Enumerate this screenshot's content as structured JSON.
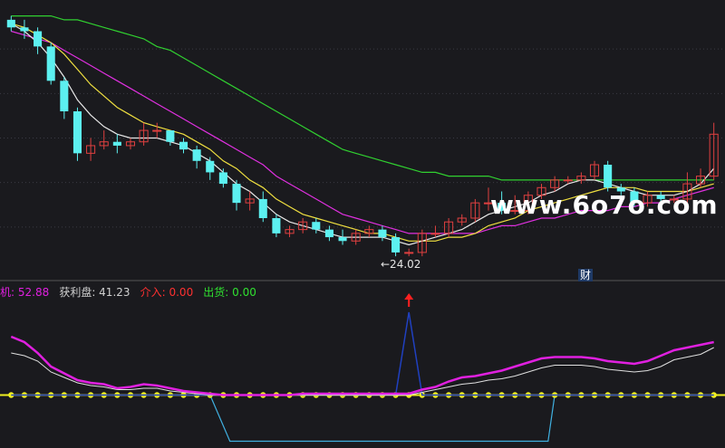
{
  "colors": {
    "background": "#1a1a1e",
    "gridline": "#3a3a44",
    "up_candle": "#e04040",
    "down_candle": "#5cf0f0",
    "ma_white": "#e8e8e8",
    "ma_yellow": "#f0e040",
    "ma_magenta": "#e030e0",
    "ma_green": "#30d030",
    "ind_magenta": "#e020e0",
    "ind_white": "#e0e0e0",
    "ind_yellow": "#f0f020",
    "ind_blue": "#2040c0",
    "ind_cyan": "#40b0e0",
    "signal_red": "#ff2020"
  },
  "chart_labels": {
    "low_price_label": "←24.02",
    "event_marker": "财",
    "watermark": "www.6o7o.com"
  },
  "indicator_bar": [
    {
      "text": "机: 52.88",
      "color": "#e020e0"
    },
    {
      "text": "获利盘: 41.23",
      "color": "#d0d0d0"
    },
    {
      "text": "介入: 0.00",
      "color": "#ff3030"
    },
    {
      "text": "出货: 0.00",
      "color": "#30e030"
    }
  ],
  "chart_data": [
    {
      "type": "candlestick",
      "x": [
        1,
        2,
        3,
        4,
        5,
        6,
        7,
        8,
        9,
        10,
        11,
        12,
        13,
        14,
        15,
        16,
        17,
        18,
        19,
        20,
        21,
        22,
        23,
        24,
        25,
        26,
        27,
        28,
        29,
        30,
        31,
        32,
        33,
        34,
        35,
        36,
        37,
        38,
        39,
        40,
        41,
        42,
        43,
        44,
        45,
        46,
        47,
        48,
        49,
        50,
        51,
        52,
        53,
        54
      ],
      "open": [
        30.2,
        30.0,
        29.9,
        29.5,
        28.6,
        27.8,
        26.7,
        26.9,
        27.0,
        26.9,
        27.0,
        27.3,
        27.3,
        27.0,
        26.8,
        26.5,
        26.2,
        25.9,
        25.4,
        25.5,
        25.0,
        24.6,
        24.7,
        24.9,
        24.7,
        24.5,
        24.4,
        24.6,
        24.7,
        24.5,
        24.1,
        24.1,
        24.6,
        24.6,
        24.9,
        25.0,
        25.4,
        25.4,
        25.2,
        25.2,
        25.6,
        25.8,
        26.0,
        26.0,
        26.1,
        26.4,
        25.8,
        25.7,
        25.4,
        25.6,
        25.5,
        25.5,
        25.9,
        26.1
      ],
      "close": [
        30.0,
        29.9,
        29.5,
        28.6,
        27.8,
        26.7,
        26.9,
        27.0,
        26.9,
        27.0,
        27.3,
        27.3,
        27.0,
        26.8,
        26.5,
        26.2,
        25.9,
        25.4,
        25.5,
        25.0,
        24.6,
        24.7,
        24.9,
        24.7,
        24.5,
        24.4,
        24.6,
        24.7,
        24.5,
        24.1,
        24.1,
        24.6,
        24.6,
        24.9,
        25.0,
        25.4,
        25.4,
        25.2,
        25.2,
        25.6,
        25.8,
        26.0,
        26.0,
        26.1,
        26.4,
        25.8,
        25.7,
        25.4,
        25.6,
        25.5,
        25.5,
        25.9,
        26.1,
        27.2
      ],
      "high": [
        30.3,
        30.2,
        30.0,
        29.6,
        28.7,
        27.9,
        27.1,
        27.3,
        27.2,
        27.1,
        27.5,
        27.5,
        27.3,
        27.1,
        26.9,
        26.6,
        26.3,
        26.0,
        25.7,
        25.7,
        25.1,
        24.8,
        25.0,
        25.0,
        24.8,
        24.7,
        24.7,
        24.8,
        24.8,
        24.6,
        24.2,
        24.7,
        24.8,
        25.0,
        25.1,
        25.5,
        25.8,
        25.7,
        25.6,
        25.7,
        25.9,
        26.1,
        26.1,
        26.2,
        26.5,
        26.5,
        25.9,
        25.8,
        25.7,
        25.7,
        25.6,
        26.2,
        26.3,
        27.5
      ],
      "low": [
        29.9,
        29.7,
        29.3,
        28.5,
        27.6,
        26.5,
        26.5,
        26.8,
        26.7,
        26.8,
        26.9,
        27.1,
        26.9,
        26.7,
        26.3,
        26.0,
        25.8,
        25.2,
        25.2,
        24.9,
        24.5,
        24.5,
        24.6,
        24.6,
        24.4,
        24.3,
        24.3,
        24.5,
        24.4,
        24.0,
        24.0,
        24.0,
        24.5,
        24.5,
        24.8,
        24.9,
        25.2,
        25.1,
        25.1,
        25.1,
        25.5,
        25.7,
        25.9,
        25.9,
        26.0,
        25.7,
        25.6,
        25.3,
        25.3,
        25.4,
        25.4,
        25.4,
        25.8,
        26.0
      ],
      "ma_white": [
        30.1,
        29.9,
        29.6,
        29.2,
        28.7,
        28.1,
        27.7,
        27.4,
        27.2,
        27.1,
        27.1,
        27.1,
        27.0,
        26.9,
        26.7,
        26.5,
        26.2,
        25.9,
        25.7,
        25.4,
        25.1,
        24.9,
        24.8,
        24.7,
        24.6,
        24.5,
        24.5,
        24.5,
        24.5,
        24.4,
        24.3,
        24.4,
        24.5,
        24.6,
        24.7,
        24.9,
        25.1,
        25.2,
        25.3,
        25.4,
        25.6,
        25.7,
        25.9,
        26.0,
        26.0,
        25.9,
        25.8,
        25.7,
        25.6,
        25.6,
        25.6,
        25.7,
        25.9,
        26.3
      ],
      "ma_yellow": [
        30.1,
        30.0,
        29.8,
        29.6,
        29.3,
        28.9,
        28.5,
        28.2,
        27.9,
        27.7,
        27.5,
        27.4,
        27.3,
        27.2,
        27.0,
        26.8,
        26.5,
        26.3,
        26.0,
        25.8,
        25.5,
        25.3,
        25.1,
        25.0,
        24.9,
        24.8,
        24.7,
        24.6,
        24.6,
        24.5,
        24.4,
        24.4,
        24.4,
        24.5,
        24.5,
        24.6,
        24.8,
        24.9,
        25.0,
        25.2,
        25.3,
        25.4,
        25.5,
        25.6,
        25.7,
        25.8,
        25.8,
        25.8,
        25.7,
        25.7,
        25.7,
        25.7,
        25.8,
        25.9
      ],
      "ma_magenta": [
        29.9,
        29.8,
        29.7,
        29.6,
        29.4,
        29.2,
        29.0,
        28.8,
        28.6,
        28.4,
        28.2,
        28.0,
        27.8,
        27.6,
        27.4,
        27.2,
        27.0,
        26.8,
        26.6,
        26.4,
        26.1,
        25.9,
        25.7,
        25.5,
        25.3,
        25.1,
        25.0,
        24.9,
        24.8,
        24.7,
        24.6,
        24.6,
        24.6,
        24.6,
        24.6,
        24.6,
        24.7,
        24.8,
        24.8,
        24.9,
        25.0,
        25.0,
        25.1,
        25.2,
        25.2,
        25.2,
        25.3,
        25.3,
        25.4,
        25.4,
        25.5,
        25.6,
        25.7,
        25.8
      ],
      "ma_green": [
        30.3,
        30.3,
        30.3,
        30.3,
        30.2,
        30.2,
        30.1,
        30.0,
        29.9,
        29.8,
        29.7,
        29.5,
        29.4,
        29.2,
        29.0,
        28.8,
        28.6,
        28.4,
        28.2,
        28.0,
        27.8,
        27.6,
        27.4,
        27.2,
        27.0,
        26.8,
        26.7,
        26.6,
        26.5,
        26.4,
        26.3,
        26.2,
        26.2,
        26.1,
        26.1,
        26.1,
        26.1,
        26.0,
        26.0,
        26.0,
        26.0,
        26.0,
        26.0,
        26.0,
        26.0,
        26.0,
        26.0,
        26.0,
        26.0,
        26.0,
        26.0,
        26.0,
        26.0,
        26.0
      ],
      "ylim": [
        23.6,
        30.6
      ]
    },
    {
      "type": "line",
      "x": [
        1,
        2,
        3,
        4,
        5,
        6,
        7,
        8,
        9,
        10,
        11,
        12,
        13,
        14,
        15,
        16,
        17,
        18,
        19,
        20,
        21,
        22,
        23,
        24,
        25,
        26,
        27,
        28,
        29,
        30,
        31,
        32,
        33,
        34,
        35,
        36,
        37,
        38,
        39,
        40,
        41,
        42,
        43,
        44,
        45,
        46,
        47,
        48,
        49,
        50,
        51,
        52,
        53,
        54
      ],
      "series": [
        {
          "key": "magenta",
          "values": [
            52,
            48,
            40,
            30,
            25,
            20,
            18,
            17,
            14,
            15,
            17,
            16,
            14,
            12,
            11,
            10,
            9,
            9,
            9,
            9,
            9,
            9,
            10,
            10,
            10,
            10,
            10,
            10,
            10,
            10,
            10,
            13,
            15,
            19,
            22,
            23,
            25,
            27,
            30,
            33,
            36,
            37,
            37,
            37,
            36,
            34,
            33,
            32,
            34,
            38,
            42,
            44,
            46,
            48
          ]
        },
        {
          "key": "white",
          "values": [
            40,
            38,
            34,
            26,
            22,
            18,
            16,
            15,
            13,
            13,
            14,
            14,
            12,
            11,
            10,
            9,
            9,
            9,
            9,
            9,
            9,
            9,
            9,
            9,
            9,
            9,
            9,
            9,
            9,
            9,
            9,
            11,
            13,
            15,
            17,
            18,
            20,
            21,
            23,
            26,
            29,
            31,
            31,
            31,
            30,
            28,
            27,
            26,
            27,
            30,
            35,
            37,
            39,
            44
          ]
        },
        {
          "key": "blue",
          "values": [
            9,
            9,
            9,
            9,
            9,
            9,
            9,
            9,
            9,
            9,
            9,
            9,
            9,
            9,
            9,
            9,
            9,
            9,
            9,
            9,
            9,
            9,
            9,
            9,
            9,
            9,
            9,
            9,
            9,
            9,
            70,
            9,
            9,
            9,
            9,
            9,
            9,
            9,
            9,
            9,
            9,
            9,
            9,
            9,
            9,
            9,
            9,
            9,
            9,
            9,
            9,
            9,
            9,
            9
          ]
        }
      ],
      "baseline": 9,
      "cyan_trough": {
        "from": 16,
        "to": 42,
        "depth": -25
      },
      "signal_arrow_at": 31,
      "ylim": [
        -30,
        80
      ]
    }
  ]
}
